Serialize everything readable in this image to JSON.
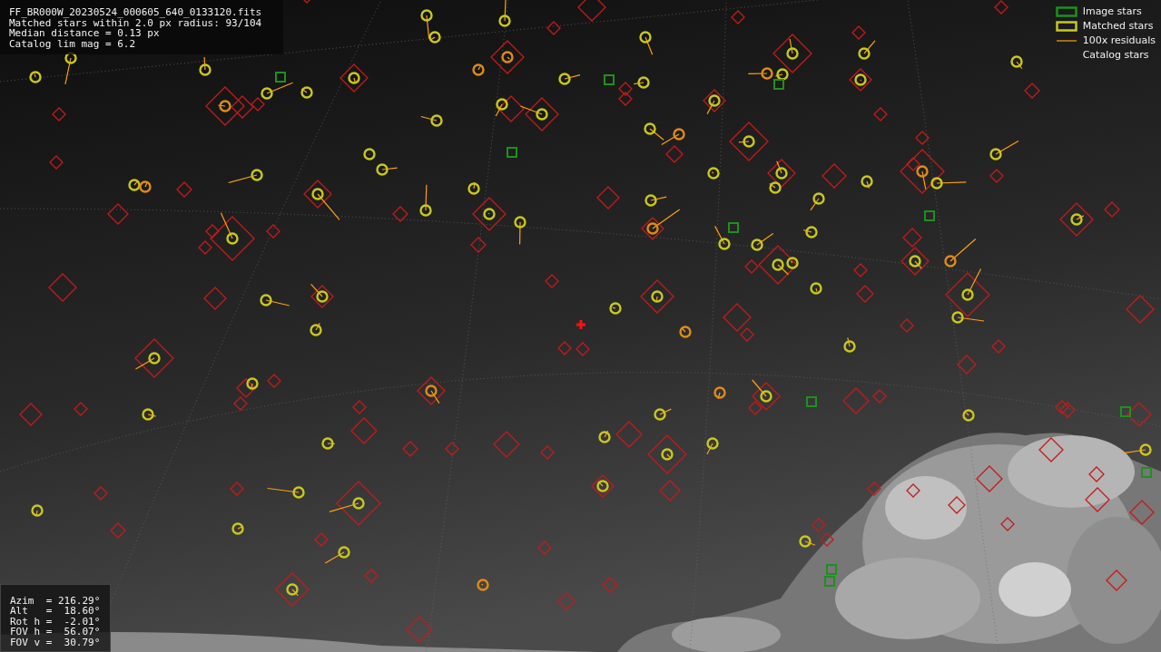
{
  "image_info": {
    "lines": [
      "FF_BR000W_20230524_000605_640_0133120.fits",
      "Matched stars within 2.0 px radius: 93/104",
      "Median distance = 0.13 px",
      "Catalog lim mag = 6.2"
    ]
  },
  "legend": [
    {
      "label": "Image stars"
    },
    {
      "kind": "matched",
      "label": "Matched stars"
    },
    {
      "kind": "residual",
      "label": "100x residuals"
    },
    {
      "kind": "catalog",
      "label": "Catalog stars"
    }
  ],
  "pointing": {
    "lines": [
      "Azim  = 216.29°",
      "Alt   =  18.60°",
      "Rot h =  -2.01°",
      "FOV h =  56.07°",
      "FOV v =  30.79°"
    ]
  }
}
